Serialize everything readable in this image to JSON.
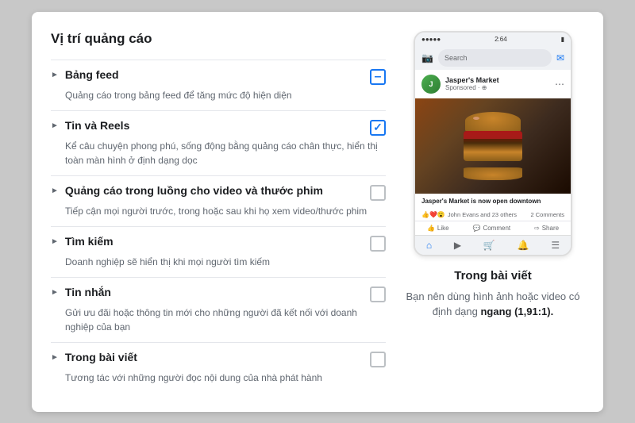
{
  "panel": {
    "title": "Vị trí quảng cáo",
    "items": [
      {
        "id": "bang-feed",
        "name": "Bảng feed",
        "desc": "Quảng cáo trong bảng feed để tăng mức độ hiện diện",
        "checkbox": "minus",
        "expanded": false
      },
      {
        "id": "tin-va-reels",
        "name": "Tin và Reels",
        "desc": "Kể câu chuyện phong phú, sống động bằng quảng cáo chân thực, hiển thị toàn màn hình ở định dạng dọc",
        "checkbox": "checked",
        "expanded": false
      },
      {
        "id": "quang-cao-video",
        "name": "Quảng cáo trong luồng cho video và thước phim",
        "desc": "Tiếp cận mọi người trước, trong hoặc sau khi họ xem video/thước phim",
        "checkbox": "empty",
        "expanded": false
      },
      {
        "id": "tim-kiem",
        "name": "Tìm kiếm",
        "desc": "Doanh nghiệp sẽ hiển thị khi mọi người tìm kiếm",
        "checkbox": "empty",
        "expanded": false
      },
      {
        "id": "tin-nhan",
        "name": "Tin nhắn",
        "desc": "Gửi ưu đãi hoặc thông tin mới cho những người đã kết nối với doanh nghiệp của bạn",
        "checkbox": "empty",
        "expanded": false
      },
      {
        "id": "trong-bai-viet",
        "name": "Trong bài viết",
        "desc": "Tương tác với những người đọc nội dung của nhà phát hành",
        "checkbox": "empty",
        "expanded": false
      }
    ]
  },
  "phone": {
    "time": "2:64",
    "signal": "●●●●●",
    "search_placeholder": "Search",
    "poster_name": "Jasper's Market",
    "poster_subtitle": "Sponsored · ⊕",
    "post_caption": "Jasper's Market is now open downtown",
    "reactions_text": "John Evans and 23 others",
    "comments_text": "2 Comments",
    "action_like": "Like",
    "action_comment": "Comment",
    "action_share": "Share"
  },
  "info": {
    "title": "Trong bài viết",
    "desc_part1": "Bạn nên dùng hình ảnh hoặc video có định dạng ",
    "desc_bold": "ngang (1,91:1).",
    "desc_part2": ""
  }
}
